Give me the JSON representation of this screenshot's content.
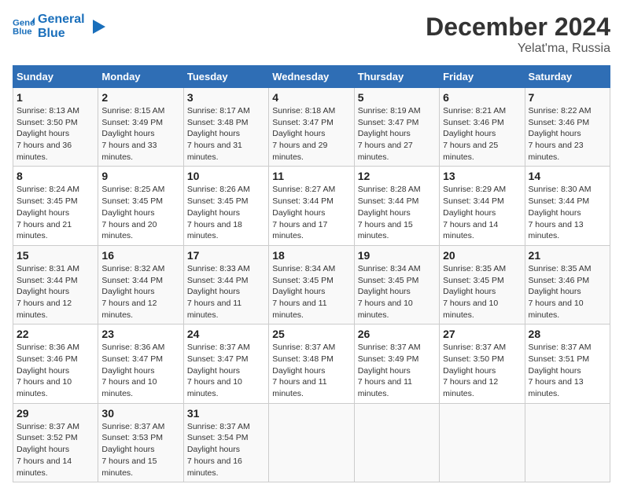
{
  "header": {
    "logo_line1": "General",
    "logo_line2": "Blue",
    "month": "December 2024",
    "location": "Yelat'ma, Russia"
  },
  "days_of_week": [
    "Sunday",
    "Monday",
    "Tuesday",
    "Wednesday",
    "Thursday",
    "Friday",
    "Saturday"
  ],
  "weeks": [
    [
      {
        "day": 1,
        "sunrise": "8:13 AM",
        "sunset": "3:50 PM",
        "daylight": "7 hours and 36 minutes."
      },
      {
        "day": 2,
        "sunrise": "8:15 AM",
        "sunset": "3:49 PM",
        "daylight": "7 hours and 33 minutes."
      },
      {
        "day": 3,
        "sunrise": "8:17 AM",
        "sunset": "3:48 PM",
        "daylight": "7 hours and 31 minutes."
      },
      {
        "day": 4,
        "sunrise": "8:18 AM",
        "sunset": "3:47 PM",
        "daylight": "7 hours and 29 minutes."
      },
      {
        "day": 5,
        "sunrise": "8:19 AM",
        "sunset": "3:47 PM",
        "daylight": "7 hours and 27 minutes."
      },
      {
        "day": 6,
        "sunrise": "8:21 AM",
        "sunset": "3:46 PM",
        "daylight": "7 hours and 25 minutes."
      },
      {
        "day": 7,
        "sunrise": "8:22 AM",
        "sunset": "3:46 PM",
        "daylight": "7 hours and 23 minutes."
      }
    ],
    [
      {
        "day": 8,
        "sunrise": "8:24 AM",
        "sunset": "3:45 PM",
        "daylight": "7 hours and 21 minutes."
      },
      {
        "day": 9,
        "sunrise": "8:25 AM",
        "sunset": "3:45 PM",
        "daylight": "7 hours and 20 minutes."
      },
      {
        "day": 10,
        "sunrise": "8:26 AM",
        "sunset": "3:45 PM",
        "daylight": "7 hours and 18 minutes."
      },
      {
        "day": 11,
        "sunrise": "8:27 AM",
        "sunset": "3:44 PM",
        "daylight": "7 hours and 17 minutes."
      },
      {
        "day": 12,
        "sunrise": "8:28 AM",
        "sunset": "3:44 PM",
        "daylight": "7 hours and 15 minutes."
      },
      {
        "day": 13,
        "sunrise": "8:29 AM",
        "sunset": "3:44 PM",
        "daylight": "7 hours and 14 minutes."
      },
      {
        "day": 14,
        "sunrise": "8:30 AM",
        "sunset": "3:44 PM",
        "daylight": "7 hours and 13 minutes."
      }
    ],
    [
      {
        "day": 15,
        "sunrise": "8:31 AM",
        "sunset": "3:44 PM",
        "daylight": "7 hours and 12 minutes."
      },
      {
        "day": 16,
        "sunrise": "8:32 AM",
        "sunset": "3:44 PM",
        "daylight": "7 hours and 12 minutes."
      },
      {
        "day": 17,
        "sunrise": "8:33 AM",
        "sunset": "3:44 PM",
        "daylight": "7 hours and 11 minutes."
      },
      {
        "day": 18,
        "sunrise": "8:34 AM",
        "sunset": "3:45 PM",
        "daylight": "7 hours and 11 minutes."
      },
      {
        "day": 19,
        "sunrise": "8:34 AM",
        "sunset": "3:45 PM",
        "daylight": "7 hours and 10 minutes."
      },
      {
        "day": 20,
        "sunrise": "8:35 AM",
        "sunset": "3:45 PM",
        "daylight": "7 hours and 10 minutes."
      },
      {
        "day": 21,
        "sunrise": "8:35 AM",
        "sunset": "3:46 PM",
        "daylight": "7 hours and 10 minutes."
      }
    ],
    [
      {
        "day": 22,
        "sunrise": "8:36 AM",
        "sunset": "3:46 PM",
        "daylight": "7 hours and 10 minutes."
      },
      {
        "day": 23,
        "sunrise": "8:36 AM",
        "sunset": "3:47 PM",
        "daylight": "7 hours and 10 minutes."
      },
      {
        "day": 24,
        "sunrise": "8:37 AM",
        "sunset": "3:47 PM",
        "daylight": "7 hours and 10 minutes."
      },
      {
        "day": 25,
        "sunrise": "8:37 AM",
        "sunset": "3:48 PM",
        "daylight": "7 hours and 11 minutes."
      },
      {
        "day": 26,
        "sunrise": "8:37 AM",
        "sunset": "3:49 PM",
        "daylight": "7 hours and 11 minutes."
      },
      {
        "day": 27,
        "sunrise": "8:37 AM",
        "sunset": "3:50 PM",
        "daylight": "7 hours and 12 minutes."
      },
      {
        "day": 28,
        "sunrise": "8:37 AM",
        "sunset": "3:51 PM",
        "daylight": "7 hours and 13 minutes."
      }
    ],
    [
      {
        "day": 29,
        "sunrise": "8:37 AM",
        "sunset": "3:52 PM",
        "daylight": "7 hours and 14 minutes."
      },
      {
        "day": 30,
        "sunrise": "8:37 AM",
        "sunset": "3:53 PM",
        "daylight": "7 hours and 15 minutes."
      },
      {
        "day": 31,
        "sunrise": "8:37 AM",
        "sunset": "3:54 PM",
        "daylight": "7 hours and 16 minutes."
      },
      null,
      null,
      null,
      null
    ]
  ]
}
